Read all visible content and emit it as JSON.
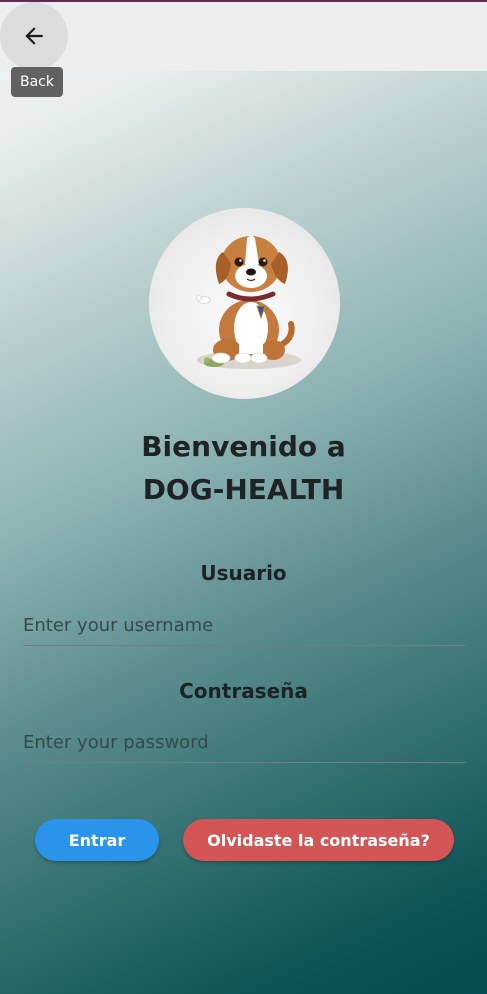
{
  "appbar": {
    "back_tooltip": "Back",
    "back_icon": "arrow-left-icon"
  },
  "avatar": {
    "icon": "puppy-illustration"
  },
  "title": {
    "line1": "Bienvenido a",
    "line2": "DOG-HEALTH"
  },
  "username": {
    "label": "Usuario",
    "placeholder": "Enter your username",
    "value": ""
  },
  "password": {
    "label": "Contraseña",
    "placeholder": "Enter your password",
    "value": ""
  },
  "buttons": {
    "enter_label": "Entrar",
    "forgot_label": "Olvidaste la contraseña?"
  },
  "colors": {
    "accent_blue": "#2a93ea",
    "accent_red": "#d35555",
    "gradient_dark": "#004c4f",
    "gradient_light": "#f3f4f4"
  }
}
